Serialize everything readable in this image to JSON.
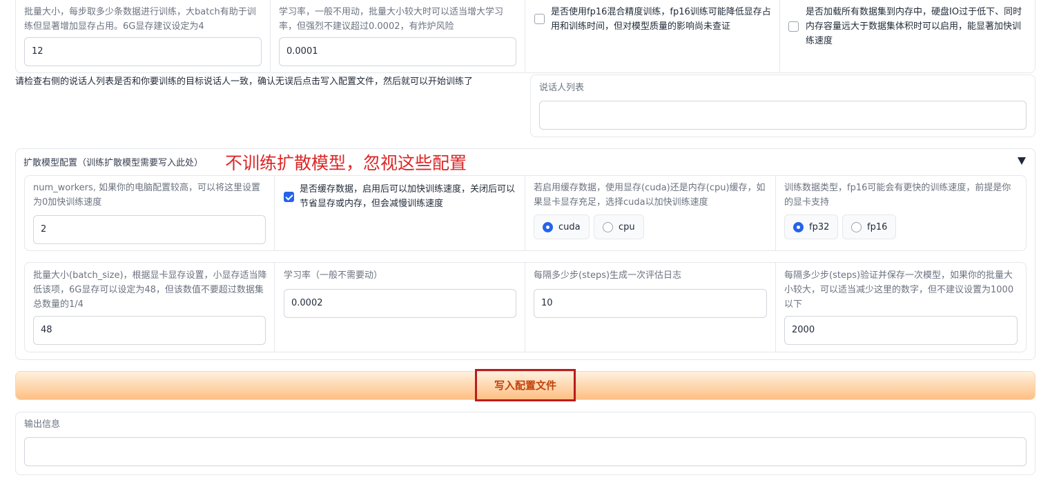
{
  "top_config": {
    "batch_size_label": "批量大小，每步取多少条数据进行训练，大batch有助于训练但显著增加显存占用。6G显存建议设定为4",
    "batch_size_value": "12",
    "lr_label": "学习率，一般不用动，批量大小较大时可以适当增大学习率，但强烈不建议超过0.0002，有炸炉风险",
    "lr_value": "0.0001",
    "fp16_label": "是否使用fp16混合精度训练，fp16训练可能降低显存占用和训练时间，但对模型质量的影响尚未查证",
    "fp16_checked": false,
    "load_all_label": "是否加载所有数据集到内存中，硬盘IO过于低下、同时内存容量远大于数据集体积时可以启用，能显著加快训练速度",
    "load_all_checked": false
  },
  "speaker_section": {
    "instruction": "请检查右侧的说话人列表是否和你要训练的目标说话人一致，确认无误后点击写入配置文件，然后就可以开始训练了",
    "list_label": "说话人列表",
    "list_value": ""
  },
  "diffusion": {
    "title": "扩散模型配置（训练扩散模型需要写入此处）",
    "annotation": "不训练扩散模型，忽视这些配置",
    "collapse_icon": "triangle-down-icon",
    "num_workers_label": "num_workers, 如果你的电脑配置较高，可以将这里设置为0加快训练速度",
    "num_workers_value": "2",
    "cache_label": "是否缓存数据，启用后可以加快训练速度，关闭后可以节省显存或内存，但会减慢训练速度",
    "cache_checked": true,
    "cache_device_label": "若启用缓存数据，使用显存(cuda)还是内存(cpu)缓存，如果显卡显存充足，选择cuda以加快训练速度",
    "cache_device_options": [
      "cuda",
      "cpu"
    ],
    "cache_device_selected": "cuda",
    "dtype_label": "训练数据类型，fp16可能会有更快的训练速度，前提是你的显卡支持",
    "dtype_options": [
      "fp32",
      "fp16"
    ],
    "dtype_selected": "fp32",
    "batch_label": "批量大小(batch_size)，根据显卡显存设置，小显存适当降低该项，6G显存可以设定为48，但该数值不要超过数据集总数量的1/4",
    "batch_value": "48",
    "lr_label": "学习率（一般不需要动）",
    "lr_value": "0.0002",
    "log_interval_label": "每隔多少步(steps)生成一次评估日志",
    "log_interval_value": "10",
    "save_interval_label": "每隔多少步(steps)验证并保存一次模型，如果你的批量大小较大，可以适当减少这里的数字，但不建议设置为1000以下",
    "save_interval_value": "2000"
  },
  "write_button_label": "写入配置文件",
  "output": {
    "label": "输出信息",
    "value": ""
  },
  "colors": {
    "accent": "#2563eb",
    "button_text": "#c2410c",
    "annotation": "#dc2626",
    "highlight_border": "#b91c1c"
  }
}
